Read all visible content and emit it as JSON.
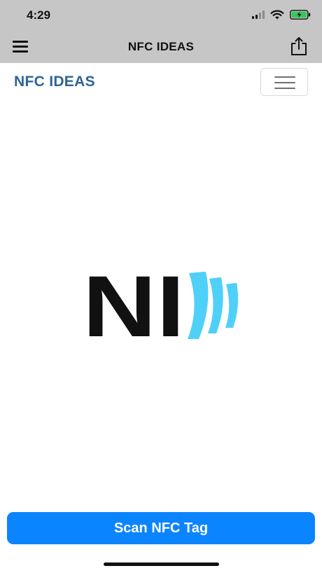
{
  "status_bar": {
    "time": "4:29",
    "icons": [
      "cellular-signal-icon",
      "wifi-icon",
      "battery-charging-icon"
    ],
    "battery_color": "#34c759"
  },
  "nav_bar": {
    "title": "NFC IDEAS",
    "left_icon": "hamburger-menu-icon",
    "right_icon": "share-icon",
    "background": "#c6c6c6"
  },
  "web_header": {
    "brand": "NFC IDEAS",
    "brand_color": "#2f6496",
    "toggler_icon": "navbar-toggler-icon"
  },
  "logo": {
    "text": "NI",
    "wave_color": "#4fd0f8",
    "text_color": "#111111"
  },
  "scan_button": {
    "label": "Scan NFC Tag",
    "color": "#0b84ff"
  }
}
